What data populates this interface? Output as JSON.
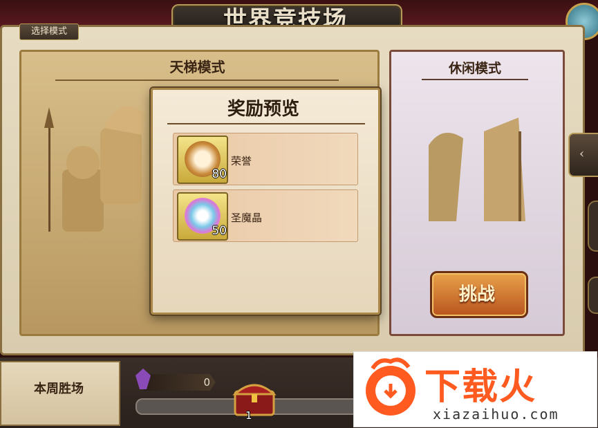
{
  "header": {
    "title": "世界竞技场"
  },
  "mode_selector": {
    "tab_label": "选择模式"
  },
  "ranked_mode": {
    "title": "天梯模式"
  },
  "casual_mode": {
    "title": "休闲模式",
    "challenge_label": "挑战"
  },
  "reward_preview": {
    "title": "奖励预览",
    "items": [
      {
        "name": "荣誉",
        "count": "80",
        "icon": "honor-medal-icon",
        "color": "#c98a3a"
      },
      {
        "name": "圣魔晶",
        "count": "50",
        "icon": "holy-crystal-icon",
        "color": "#7ac8e8"
      }
    ]
  },
  "weekly": {
    "label": "本周胜场",
    "wins": "0",
    "chest_threshold": "1",
    "progress": 0.0
  },
  "watermark": {
    "brand": "下载火",
    "url": "xiazaihuo.com"
  },
  "colors": {
    "accent": "#ff5a1f",
    "gold": "#c9a24d",
    "parchment": "#e7dcc2"
  }
}
